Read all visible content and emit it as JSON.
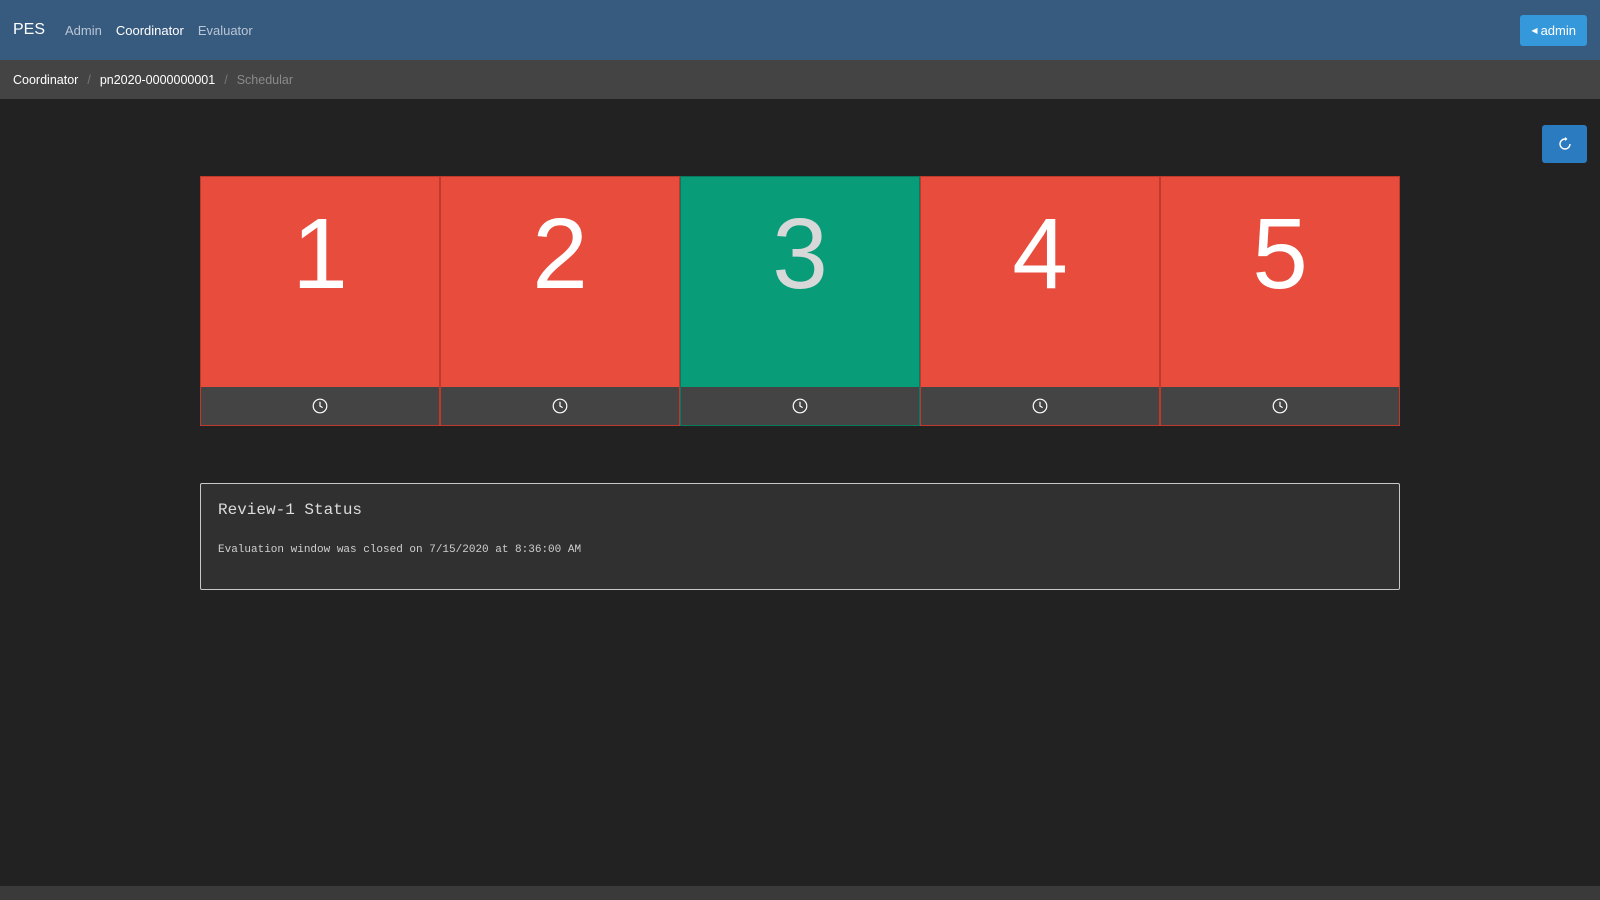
{
  "navbar": {
    "brand": "PES",
    "links": [
      {
        "label": "Admin",
        "active": false
      },
      {
        "label": "Coordinator",
        "active": true
      },
      {
        "label": "Evaluator",
        "active": false
      }
    ],
    "user_button": "admin",
    "bg_color": "#375a7f"
  },
  "breadcrumb": {
    "items": [
      "Coordinator",
      "pn2020-0000000001"
    ],
    "current": "Schedular"
  },
  "refresh_button": {
    "icon": "refresh-icon"
  },
  "tiles": [
    {
      "number": "1",
      "status": "closed",
      "color": "#e74c3c",
      "icon": "clock-icon"
    },
    {
      "number": "2",
      "status": "closed",
      "color": "#e74c3c",
      "icon": "clock-icon"
    },
    {
      "number": "3",
      "status": "selected",
      "color": "#089c78",
      "icon": "clock-icon"
    },
    {
      "number": "4",
      "status": "closed",
      "color": "#e74c3c",
      "icon": "clock-icon"
    },
    {
      "number": "5",
      "status": "closed",
      "color": "#e74c3c",
      "icon": "clock-icon"
    }
  ],
  "status_panel": {
    "title": "Review-1 Status",
    "message": "Evaluation window was closed on 7/15/2020 at 8:36:00 AM"
  }
}
